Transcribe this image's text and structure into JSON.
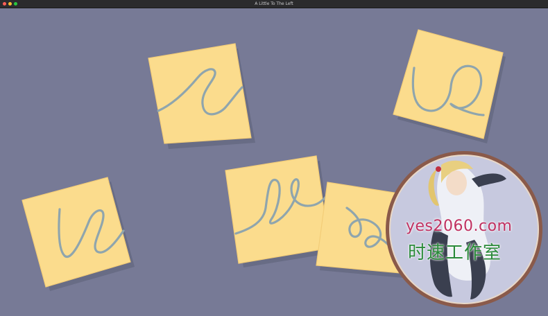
{
  "window": {
    "title": "A Little To The Left"
  },
  "watermark": {
    "site": "yes2060.com",
    "studio": "时速工作室"
  },
  "colors": {
    "background": "#777a96",
    "note": "#fbdc8d",
    "scribble": "#8fa5ad"
  },
  "notes": [
    {
      "name": "sticky-note-1"
    },
    {
      "name": "sticky-note-2"
    },
    {
      "name": "sticky-note-3"
    },
    {
      "name": "sticky-note-4"
    },
    {
      "name": "sticky-note-5"
    },
    {
      "name": "sticky-note-6"
    }
  ]
}
